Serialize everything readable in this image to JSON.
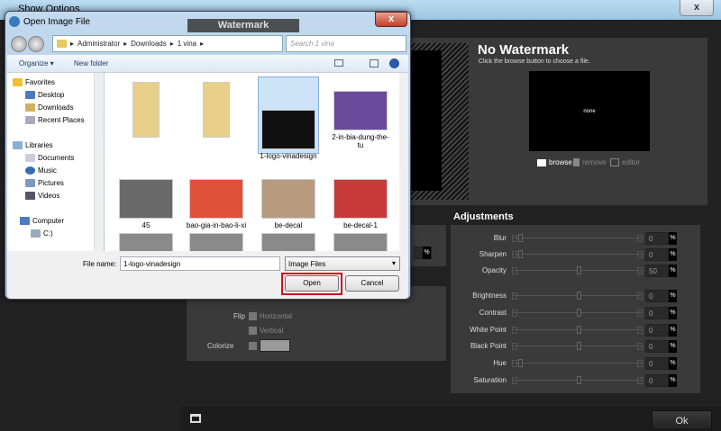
{
  "window": {
    "title": "Show Options",
    "close": "x"
  },
  "app": {
    "tab": "Watermark",
    "watermark": {
      "title": "No Watermark",
      "subtitle": "Click the browse button to choose a file.",
      "preview_text": "none",
      "browse": "browse",
      "remove": "remove",
      "editor": "editor"
    },
    "adjustments": {
      "title": "Adjustments",
      "rows": [
        {
          "label": "Blur",
          "value": "0",
          "pct": "%",
          "position": 0
        },
        {
          "label": "Sharpen",
          "value": "0",
          "pct": "%",
          "position": 0
        },
        {
          "label": "Opacity",
          "value": "50",
          "pct": "%",
          "position": 0.5
        },
        {
          "label": "Brightness",
          "value": "0",
          "pct": "%",
          "position": 0.5
        },
        {
          "label": "Contrast",
          "value": "0",
          "pct": "%",
          "position": 0.5
        },
        {
          "label": "White Point",
          "value": "0",
          "pct": "%",
          "position": 0.5
        },
        {
          "label": "Black Point",
          "value": "0",
          "pct": "%",
          "position": 0.5
        },
        {
          "label": "Hue",
          "value": "0",
          "pct": "%",
          "position": 0
        },
        {
          "label": "Saturation",
          "value": "0",
          "pct": "%",
          "position": 0.5
        }
      ]
    },
    "transform": {
      "pct": "%",
      "flip": "Flip",
      "horizontal": "Horizontal",
      "vertical": "Vertical",
      "colorize": "Colorize",
      "colorize_color": "#999999"
    },
    "ok": "Ok"
  },
  "dialog": {
    "title": "Open Image File",
    "close": "x",
    "path": [
      "Administrator",
      "Downloads",
      "1 vina"
    ],
    "search_placeholder": "Search 1 vina",
    "organize": "Organize ▾",
    "new_folder": "New folder",
    "nav": {
      "favorites": "Favorites",
      "desktop": "Desktop",
      "downloads": "Downloads",
      "recent": "Recent Places",
      "libraries": "Libraries",
      "documents": "Documents",
      "music": "Music",
      "pictures": "Pictures",
      "videos": "Videos",
      "computer": "Computer",
      "drive": "C:)"
    },
    "files": [
      {
        "name": "",
        "color": "#e8d08a"
      },
      {
        "name": "",
        "color": "#e8d08a"
      },
      {
        "name": "1-logo-vinadesign",
        "color": "#111111",
        "selected": true
      },
      {
        "name": "2-in-bia-dung-the-tu",
        "color": "#6a4a9a"
      },
      {
        "name": "45",
        "color": "#6a6a6a"
      },
      {
        "name": "bao-gia-in-bao-li-xi",
        "color": "#e0503a"
      },
      {
        "name": "be-decal",
        "color": "#b89a80"
      },
      {
        "name": "be-decal-1",
        "color": "#c83a3a"
      }
    ],
    "filename_label": "File name:",
    "filename": "1-logo-vinadesign",
    "filetype": "Image Files",
    "open": "Open",
    "cancel": "Cancel",
    "accent": "#d0101a"
  }
}
